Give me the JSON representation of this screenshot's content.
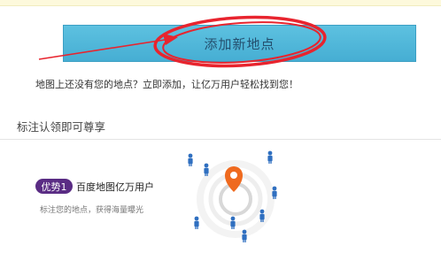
{
  "add_place_button": {
    "label": "添加新地点"
  },
  "info_text": "地图上还没有您的地点？立即添加，让亿万用户轻松找到您！",
  "section": {
    "heading": "标注认领即可尊享"
  },
  "advantage": {
    "badge": "优势1",
    "title": "百度地图亿万用户",
    "description": "标注您的地点，获得海量曝光"
  },
  "colors": {
    "button": "#4fb7db",
    "annotation_red": "#e8242e",
    "badge": "#5a2c84",
    "pin": "#ef6a1f",
    "person": "#2f6fc0"
  },
  "icons": [
    "map-pin-icon",
    "person-icon"
  ]
}
